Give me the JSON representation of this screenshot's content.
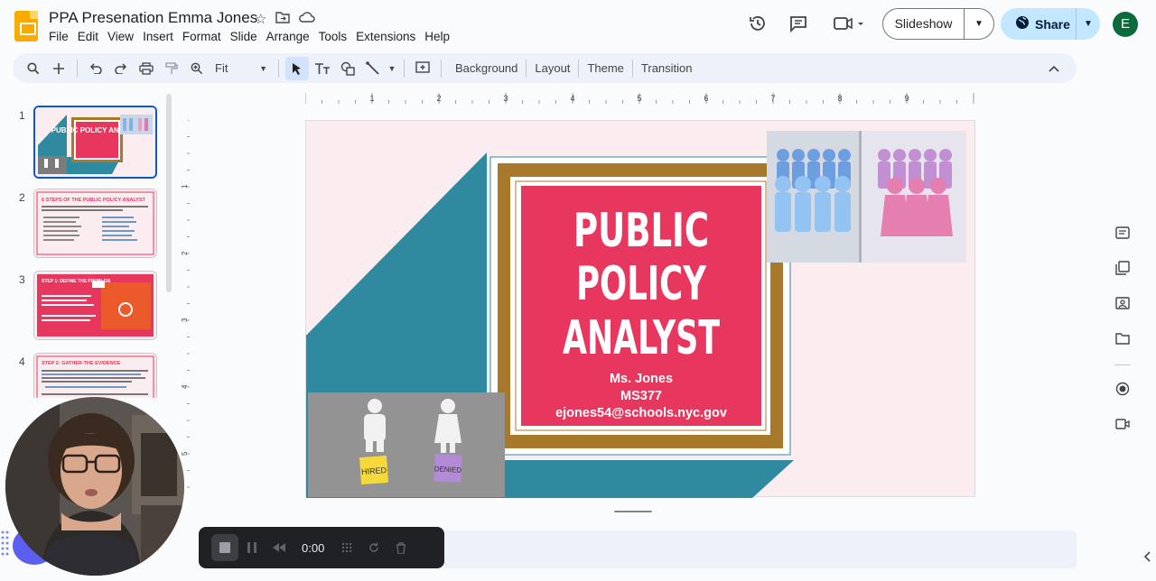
{
  "header": {
    "title": "PPA Presenation Emma Jones",
    "menu": [
      "File",
      "Edit",
      "View",
      "Insert",
      "Format",
      "Slide",
      "Arrange",
      "Tools",
      "Extensions",
      "Help"
    ],
    "slideshow_label": "Slideshow",
    "share_label": "Share",
    "avatar_initial": "E"
  },
  "toolbar": {
    "zoom": "Fit",
    "background_label": "Background",
    "layout_label": "Layout",
    "theme_label": "Theme",
    "transition_label": "Transition"
  },
  "filmstrip": {
    "slides": [
      {
        "number": "1",
        "title": "PUBLIC POLICY ANALYST"
      },
      {
        "number": "2",
        "title": "6 STEPS OF THE PUBLIC POLICY ANALYST"
      },
      {
        "number": "3",
        "title": "STEP 1: DEFINE THE PROBLEM"
      },
      {
        "number": "4",
        "title": "STEP 2: GATHER THE EVIDENCE"
      }
    ]
  },
  "ruler": {
    "h_ticks": [
      "1",
      "2",
      "3",
      "4",
      "5",
      "6",
      "7",
      "8",
      "9"
    ],
    "v_ticks": [
      "1",
      "2",
      "3",
      "4",
      "5"
    ]
  },
  "slide": {
    "title_line1": "PUBLIC",
    "title_line2": "POLICY",
    "title_line3": "ANALYST",
    "presenter": "Ms. Jones",
    "school": "MS377",
    "email": "ejones54@schools.nyc.gov",
    "sticky_hired": "HIRED",
    "sticky_denied": "DENIED"
  },
  "recorder": {
    "time": "0:00"
  },
  "colors": {
    "teal": "#2f8aa0",
    "pink_red": "#e8375e",
    "gold": "#a8792a",
    "slide_bg": "#fbecef",
    "share_bg": "#c2e7ff"
  }
}
